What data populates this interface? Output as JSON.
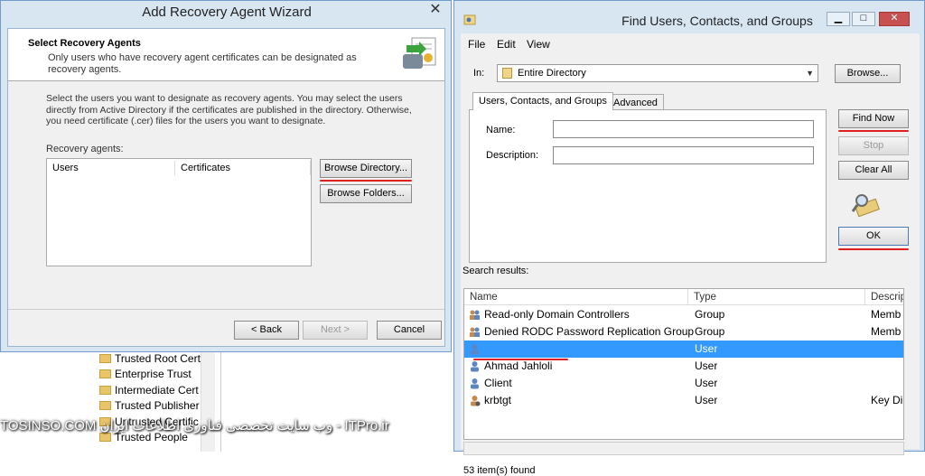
{
  "background_tree": {
    "items": [
      "Trusted Root Cert",
      "Enterprise Trust",
      "Intermediate Cert",
      "Trusted Publisher",
      "Untrusted Certific",
      "Trusted People"
    ]
  },
  "wizard": {
    "title": "Add Recovery Agent Wizard",
    "close": "✕",
    "header_title": "Select Recovery Agents",
    "header_desc": "Only users who have recovery agent certificates can be designated as recovery agents.",
    "intro": "Select the users you want to designate as recovery agents. You may select the users directly from Active Directory if the certificates are published in the directory. Otherwise, you need certificate (.cer) files for the users you want to designate.",
    "list_label": "Recovery agents:",
    "col_users": "Users",
    "col_certs": "Certificates",
    "browse_directory": "Browse Directory...",
    "browse_folders": "Browse Folders...",
    "back": "< Back",
    "next": "Next >",
    "cancel": "Cancel"
  },
  "find": {
    "title": "Find Users, Contacts, and Groups",
    "menu": [
      "File",
      "Edit",
      "View"
    ],
    "in_label": "In:",
    "in_value": "Entire Directory",
    "browse": "Browse...",
    "tab1": "Users, Contacts, and Groups",
    "tab2": "Advanced",
    "name_label": "Name:",
    "name_value": "",
    "desc_label": "Description:",
    "desc_value": "",
    "find_now": "Find Now",
    "stop": "Stop",
    "clear_all": "Clear All",
    "ok": "OK",
    "results_label": "Search results:",
    "col_name": "Name",
    "col_type": "Type",
    "col_desc": "Descrip",
    "rows": [
      {
        "name": "Read-only Domain Controllers",
        "type": "Group",
        "desc": "Memb",
        "icon": "group"
      },
      {
        "name": "Denied RODC Password Replication Group",
        "type": "Group",
        "desc": "Memb",
        "icon": "group"
      },
      {
        "name": "",
        "type": "User",
        "desc": "",
        "icon": "user"
      },
      {
        "name": "Ahmad Jahloli",
        "type": "User",
        "desc": "",
        "icon": "user"
      },
      {
        "name": "Client",
        "type": "User",
        "desc": "",
        "icon": "user"
      },
      {
        "name": "krbtgt",
        "type": "User",
        "desc": "Key Di",
        "icon": "user"
      }
    ],
    "status": "53 item(s) found"
  },
  "watermark": "TOSINSO.COM   وب سایت تخصصی فناوری اطلاعات ایران - ITPro.ir",
  "colors": {
    "accent": "#3399ff",
    "underline": "#e02020",
    "close": "#c75050"
  }
}
